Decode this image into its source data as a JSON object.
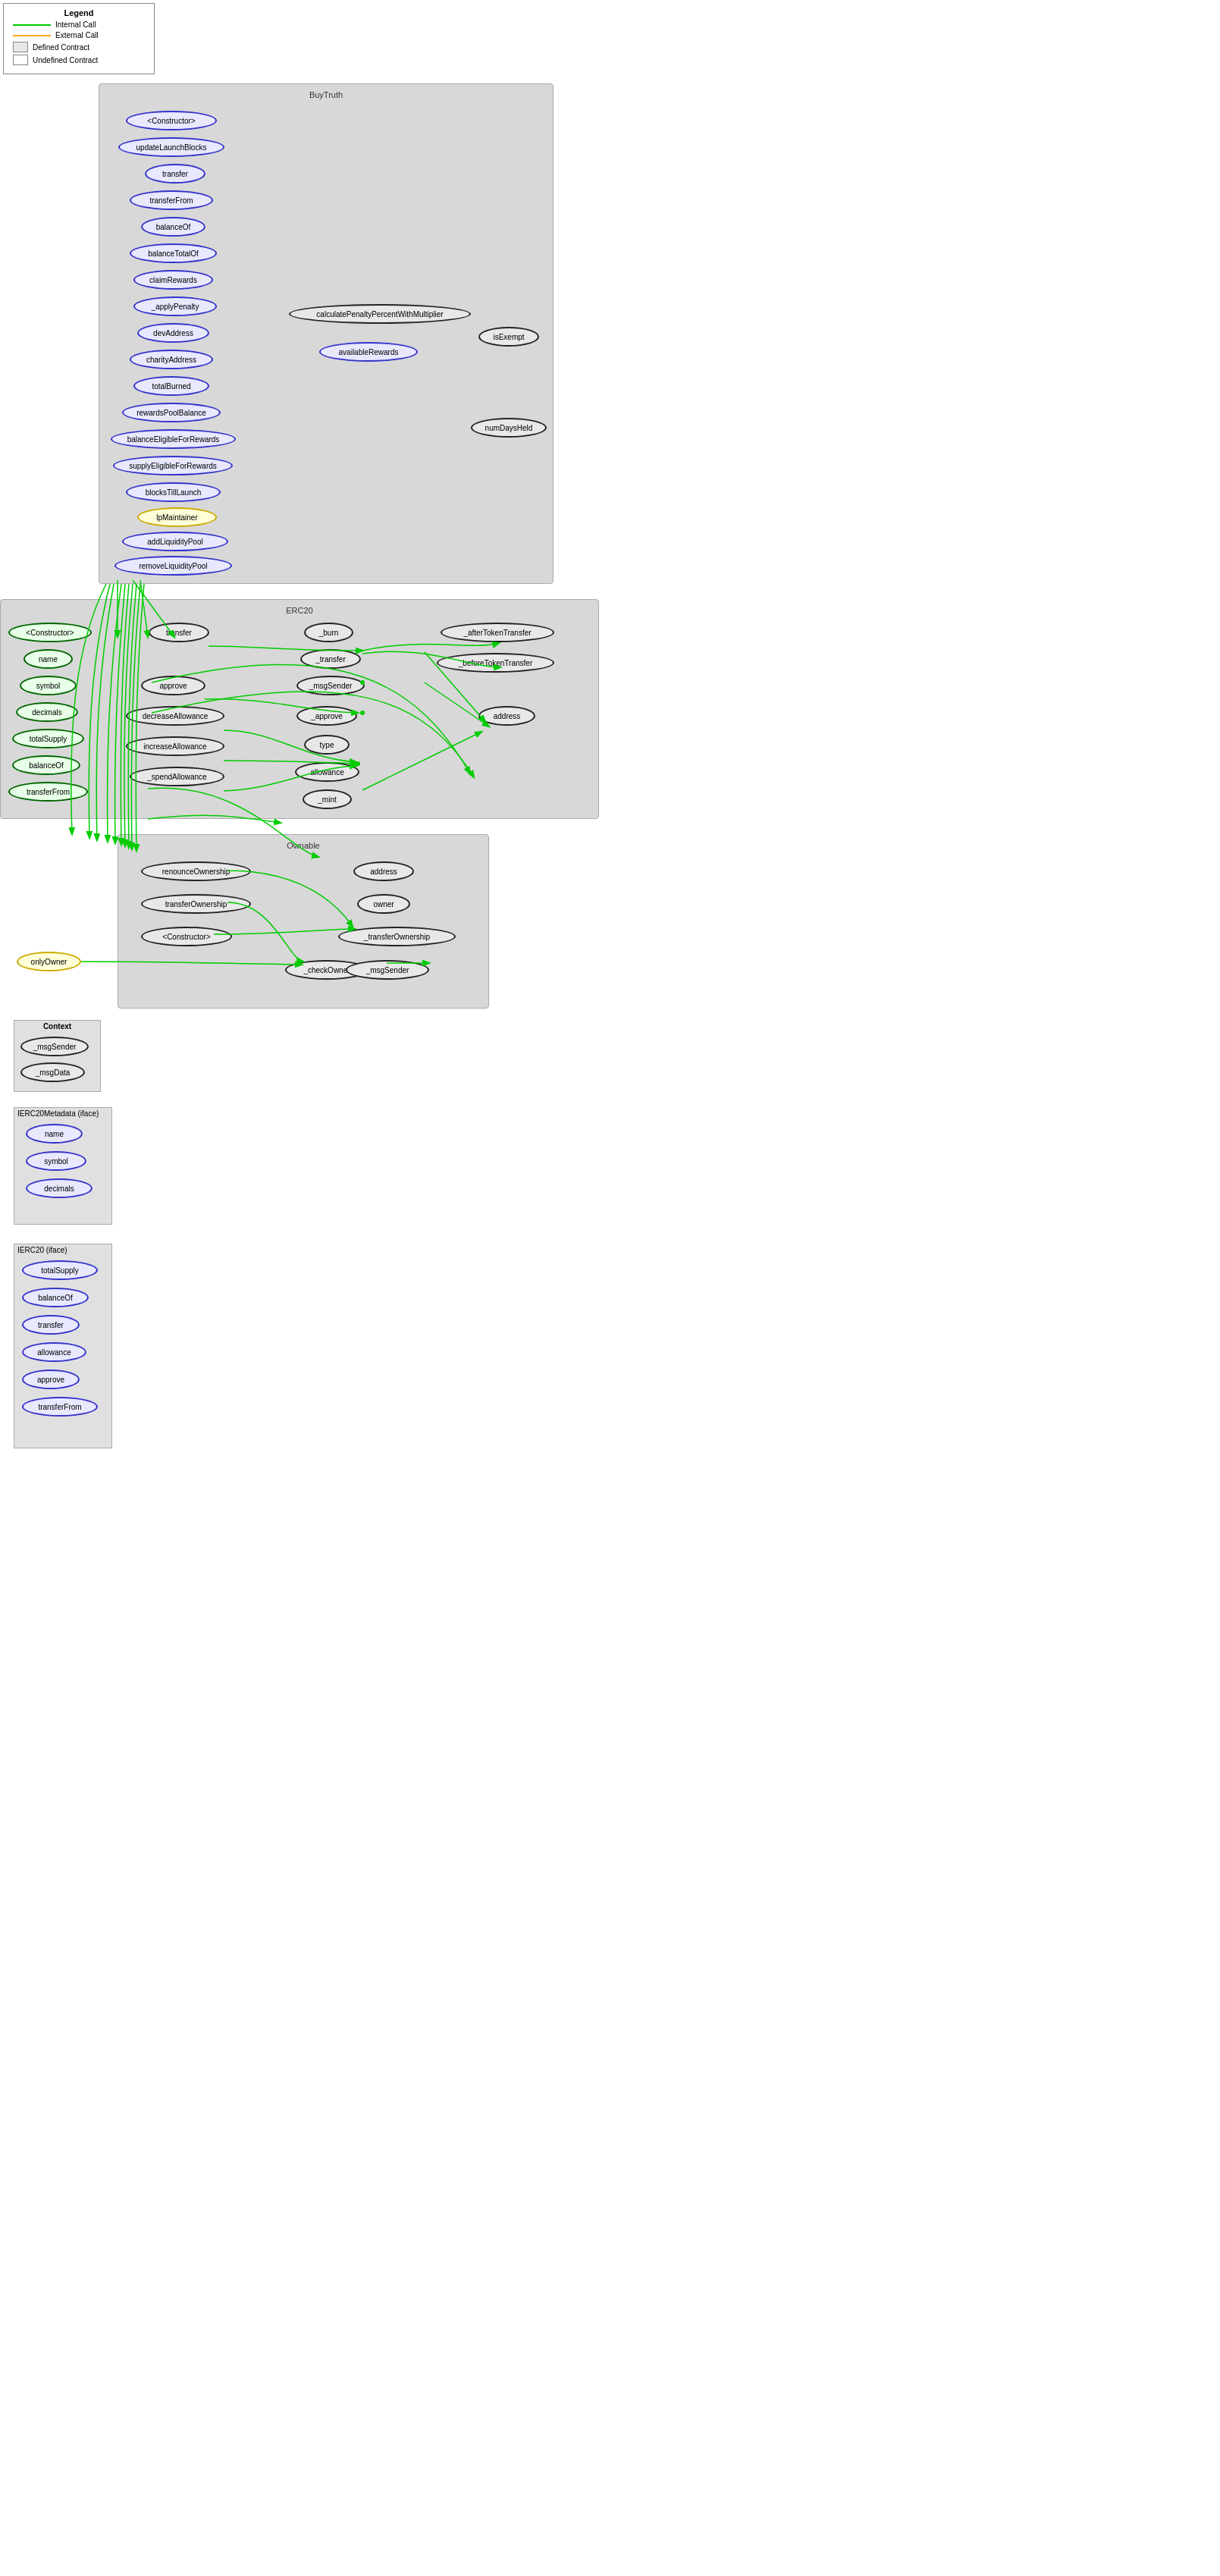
{
  "legend": {
    "title": "Legend",
    "items": [
      {
        "label": "Internal Call",
        "type": "internal"
      },
      {
        "label": "External Call",
        "type": "external"
      },
      {
        "label": "Defined Contract",
        "type": "defined"
      },
      {
        "label": "Undefined Contract",
        "type": "undefined"
      }
    ]
  },
  "contracts": {
    "BuyTruth": {
      "label": "BuyTruth",
      "nodes": [
        "Constructor",
        "updateLaunchBlocks",
        "transfer",
        "transferFrom",
        "balanceOf",
        "balanceTotalOf",
        "claimRewards",
        "_applyPenalty",
        "devAddress",
        "charityAddress",
        "totalBurned",
        "rewardsPoolBalance",
        "balanceEligibleForRewards",
        "supplyEligibleForRewards",
        "blocksTillLaunch",
        "lpMaintainer",
        "addLiquidityPool",
        "removeLiquidityPool",
        "calculatePenaltyPercentWithMultiplier",
        "availableRewards",
        "isExempt",
        "numDaysHeld"
      ]
    },
    "ERC20": {
      "label": "ERC20",
      "nodes": [
        "Constructor",
        "name",
        "symbol",
        "decimals",
        "totalSupply",
        "balanceOf",
        "transferFrom",
        "transfer",
        "approve",
        "decreaseAllowance",
        "increaseAllowance",
        "_spendAllowance",
        "_burn",
        "_transfer",
        "_msgSender",
        "_approve",
        "type",
        "allowance",
        "_mint",
        "_afterTokenTransfer",
        "_beforeTokenTransfer",
        "address"
      ]
    },
    "Ownable": {
      "label": "Ownable",
      "nodes": [
        "renounceOwnership",
        "transferOwnership",
        "Constructor",
        "onlyOwner",
        "_checkOwner",
        "address",
        "owner",
        "_transferOwnership",
        "_msgSender"
      ]
    },
    "Context": {
      "label": "Context",
      "nodes": [
        "_msgSender",
        "_msgData"
      ]
    },
    "IERC20Metadata": {
      "label": "IERC20Metadata  (iface)",
      "nodes": [
        "name",
        "symbol",
        "decimals"
      ]
    },
    "IERC20": {
      "label": "IERC20  (iface)",
      "nodes": [
        "totalSupply",
        "balanceOf",
        "transfer",
        "allowance",
        "approve",
        "transferFrom"
      ]
    }
  }
}
